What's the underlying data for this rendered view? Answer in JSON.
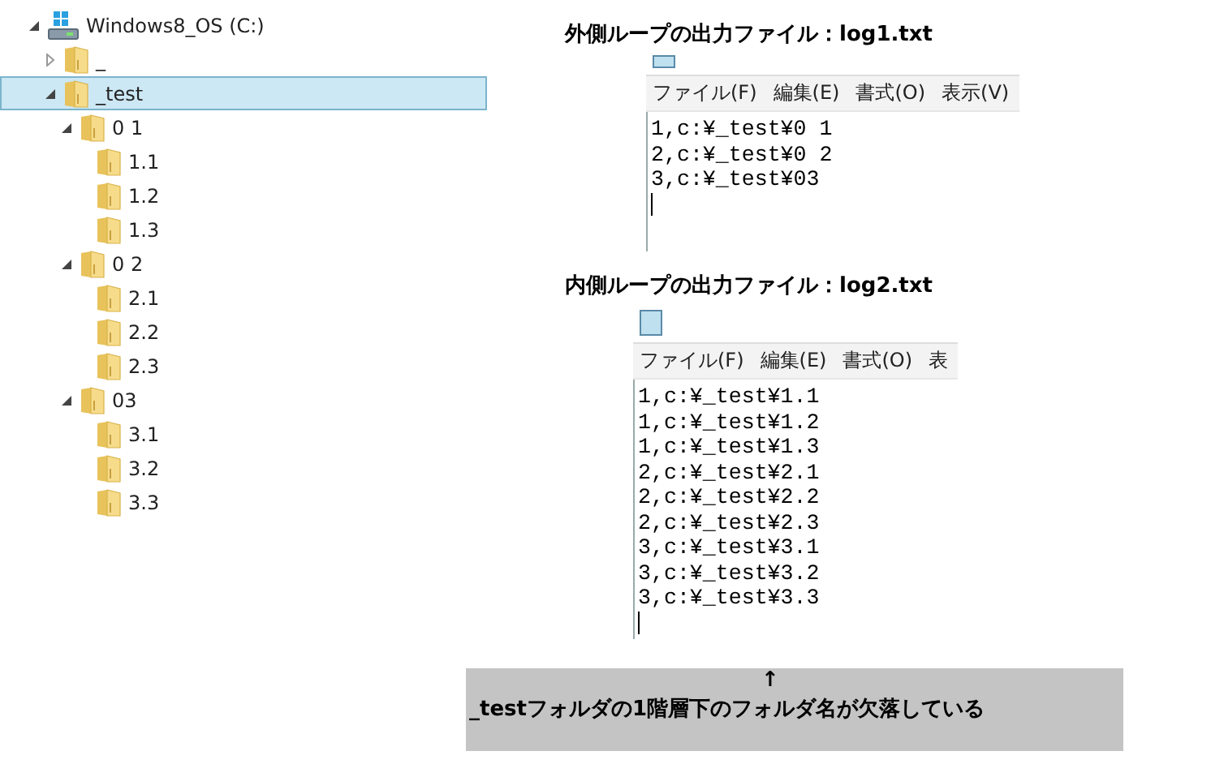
{
  "tree": [
    {
      "label": "Windows8_OS (C:)",
      "kind": "drive",
      "expanded": true,
      "selected": false,
      "children": [
        {
          "label": "_",
          "kind": "folder",
          "expanded": false,
          "selected": false
        },
        {
          "label": "_test",
          "kind": "folder",
          "expanded": true,
          "selected": true,
          "children": [
            {
              "label": "0 1",
              "kind": "folder",
              "expanded": true,
              "selected": false,
              "children": [
                {
                  "label": "1.1",
                  "kind": "folder",
                  "selected": false
                },
                {
                  "label": "1.2",
                  "kind": "folder",
                  "selected": false
                },
                {
                  "label": "1.3",
                  "kind": "folder",
                  "selected": false
                }
              ]
            },
            {
              "label": "0 2",
              "kind": "folder",
              "expanded": true,
              "selected": false,
              "children": [
                {
                  "label": "2.1",
                  "kind": "folder",
                  "selected": false
                },
                {
                  "label": "2.2",
                  "kind": "folder",
                  "selected": false
                },
                {
                  "label": "2.3",
                  "kind": "folder",
                  "selected": false
                }
              ]
            },
            {
              "label": "03",
              "kind": "folder",
              "expanded": true,
              "selected": false,
              "children": [
                {
                  "label": "3.1",
                  "kind": "folder",
                  "selected": false
                },
                {
                  "label": "3.2",
                  "kind": "folder",
                  "selected": false
                },
                {
                  "label": "3.3",
                  "kind": "folder",
                  "selected": false
                }
              ]
            }
          ]
        }
      ]
    }
  ],
  "notepads": [
    {
      "caption": "外側ループの出力ファイル：log1.txt",
      "menus": [
        "ファイル(F)",
        "編集(E)",
        "書式(O)",
        "表示(V)"
      ],
      "lines": [
        "1,c:¥_test¥0 1",
        "2,c:¥_test¥0 2",
        "3,c:¥_test¥03"
      ]
    },
    {
      "caption": "内側ループの出力ファイル：log2.txt",
      "menus": [
        "ファイル(F)",
        "編集(E)",
        "書式(O)",
        "表"
      ],
      "lines": [
        "1,c:¥_test¥1.1",
        "1,c:¥_test¥1.2",
        "1,c:¥_test¥1.3",
        "2,c:¥_test¥2.1",
        "2,c:¥_test¥2.2",
        "2,c:¥_test¥2.3",
        "3,c:¥_test¥3.1",
        "3,c:¥_test¥3.2",
        "3,c:¥_test¥3.3"
      ]
    }
  ],
  "note": {
    "arrow": "↑",
    "text": "_testフォルダの1階層下のフォルダ名が欠落している"
  }
}
